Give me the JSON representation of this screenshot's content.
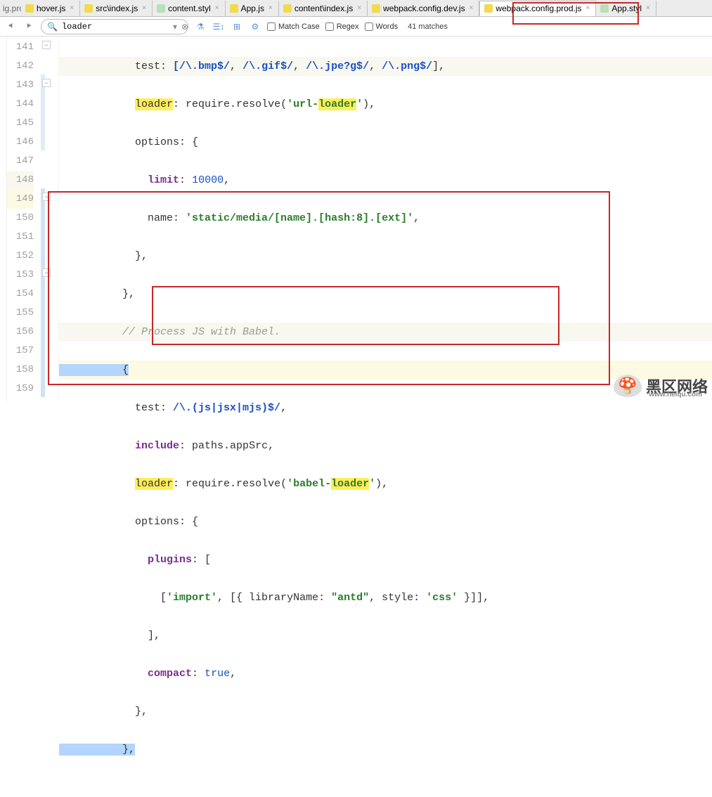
{
  "tabs": {
    "cut": "ig.prod.js",
    "items": [
      {
        "label": "hover.js",
        "icon": "js"
      },
      {
        "label": "src\\index.js",
        "icon": "js"
      },
      {
        "label": "content.styl",
        "icon": "styl"
      },
      {
        "label": "App.js",
        "icon": "js"
      },
      {
        "label": "content\\index.js",
        "icon": "js"
      },
      {
        "label": "webpack.config.dev.js",
        "icon": "js"
      },
      {
        "label": "webpack.config.prod.js",
        "icon": "js",
        "active": true
      },
      {
        "label": "App.styl",
        "icon": "styl"
      }
    ]
  },
  "search": {
    "value": "loader",
    "match_case": "Match Case",
    "regex": "Regex",
    "words": "Words",
    "matches": "41 matches"
  },
  "line_numbers": [
    "141",
    "142",
    "143",
    "144",
    "145",
    "146",
    "147",
    "148",
    "149",
    "150",
    "151",
    "152",
    "153",
    "154",
    "155",
    "156",
    "157",
    "158",
    "159"
  ],
  "code": {
    "l141_pre": "            test: ",
    "l141_r1": "[/\\.bmp$/",
    "l141_m": ", ",
    "l141_r2": "/\\.gif$/",
    "l141_m2": ", ",
    "l141_r3": "/\\.jpe?g$/",
    "l141_m3": ", ",
    "l141_r4": "/\\.png$/",
    "l141_end": "],",
    "l142_a": "            ",
    "l142_loader": "loader",
    "l142_b": ": require.resolve(",
    "l142_s1": "'url-",
    "l142_hl": "loader",
    "l142_s2": "'",
    "l142_c": "),",
    "l143": "            options: {",
    "l144_a": "              ",
    "l144_k": "limit",
    "l144_b": ": ",
    "l144_n": "10000",
    "l144_c": ",",
    "l145_a": "              name: ",
    "l145_s": "'static/media/[name].[hash:8].[ext]'",
    "l145_c": ",",
    "l146": "            },",
    "l147": "          },",
    "l148_a": "          ",
    "l148_c": "// Process JS with Babel.",
    "l149": "          {",
    "l150_a": "            test: ",
    "l150_r": "/\\.(js|jsx|mjs)$/",
    "l150_c": ",",
    "l151_a": "            ",
    "l151_k": "include",
    "l151_b": ": paths.appSrc,",
    "l152_a": "            ",
    "l152_loader": "loader",
    "l152_b": ": require.resolve(",
    "l152_s1": "'babel-",
    "l152_hl": "loader",
    "l152_s2": "'",
    "l152_c": "),",
    "l153": "            options: {",
    "l154_a": "              ",
    "l154_k": "plugins",
    "l154_b": ": [",
    "l155_a": "                [",
    "l155_s1": "'import'",
    "l155_b": ", [{ libraryName: ",
    "l155_s2": "\"antd\"",
    "l155_c": ", style: ",
    "l155_s3": "'css'",
    "l155_d": " }]],",
    "l156": "              ],",
    "l157_a": "              ",
    "l157_k": "compact",
    "l157_b": ": ",
    "l157_v": "true",
    "l157_c": ",",
    "l158": "            },",
    "l159": "          },"
  },
  "watermark": {
    "big": "黑区网络",
    "small": "www.heiqu.com"
  }
}
